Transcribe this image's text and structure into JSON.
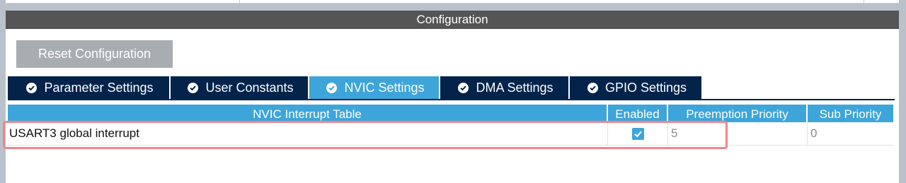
{
  "panel": {
    "title": "Configuration"
  },
  "toolbar": {
    "reset_label": "Reset Configuration"
  },
  "tabs": [
    {
      "label": "Parameter Settings",
      "icon": "check-circle-icon",
      "active": false
    },
    {
      "label": "User Constants",
      "icon": "check-circle-icon",
      "active": false
    },
    {
      "label": "NVIC Settings",
      "icon": "check-circle-icon",
      "active": true
    },
    {
      "label": "DMA Settings",
      "icon": "check-circle-icon",
      "active": false
    },
    {
      "label": "GPIO Settings",
      "icon": "check-circle-icon",
      "active": false
    }
  ],
  "table": {
    "columns": [
      "NVIC Interrupt Table",
      "Enabled",
      "Preemption Priority",
      "Sub Priority"
    ],
    "rows": [
      {
        "name": "USART3 global interrupt",
        "enabled": true,
        "preemption": "5",
        "sub": "0"
      }
    ]
  },
  "colors": {
    "title_bar": "#555555",
    "tab_bg": "#03234b",
    "tab_active": "#3da5d9",
    "table_header": "#3da5d9",
    "highlight": "#f0868a"
  }
}
